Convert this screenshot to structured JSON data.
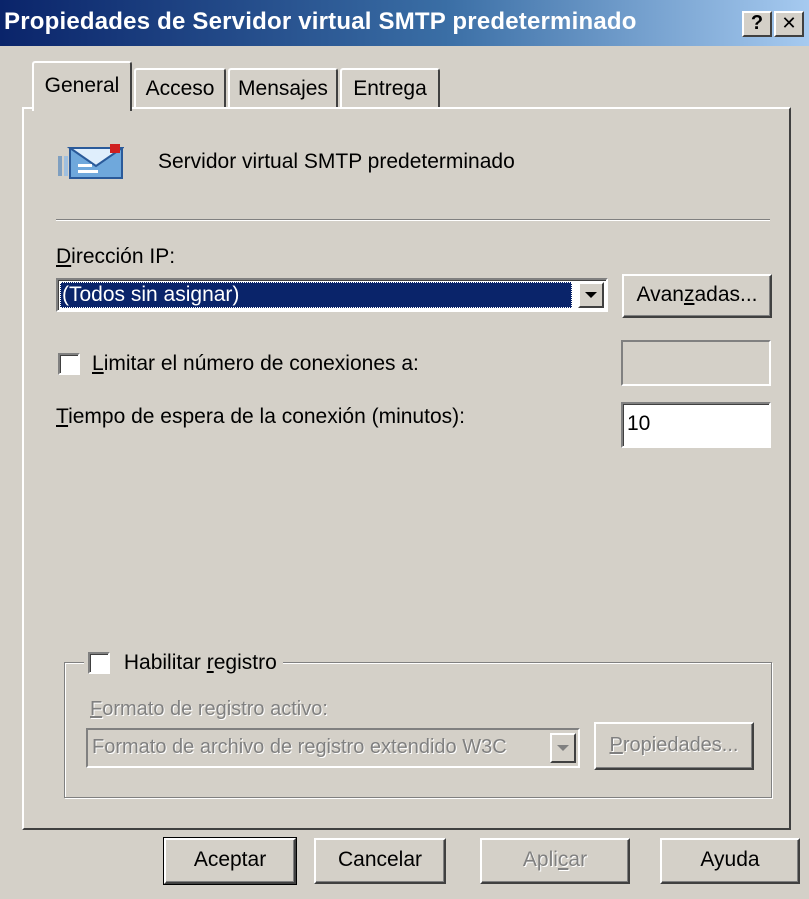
{
  "window": {
    "title": "Propiedades de Servidor virtual SMTP predeterminado",
    "help_button": "?",
    "close_button": "✕",
    "accent": "#0a246a"
  },
  "tabs": [
    {
      "label": "General",
      "active": true
    },
    {
      "label": "Acceso",
      "active": false
    },
    {
      "label": "Mensajes",
      "active": false
    },
    {
      "label": "Entrega",
      "active": false
    }
  ],
  "general": {
    "server_icon": "smtp-mail-server-icon",
    "server_name": "Servidor virtual SMTP predeterminado",
    "ip_label_access": "D",
    "ip_label_rest": "irección IP:",
    "ip_selected": "(Todos sin asignar)",
    "advanced_pre": "Avan",
    "advanced_access": "z",
    "advanced_post": "adas...",
    "limit_checked": false,
    "limit_label_access": "L",
    "limit_label_rest": "imitar el número de conexiones a:",
    "limit_value": "",
    "timeout_label_access": "T",
    "timeout_label_rest": "iempo de espera de la conexión (minutos):",
    "timeout_value": "10"
  },
  "logging": {
    "enabled": false,
    "enable_pre": "Habilitar ",
    "enable_access": "r",
    "enable_post": "egistro",
    "format_label_access": "F",
    "format_label_rest": "ormato de registro activo:",
    "format_selected": "Formato de archivo de registro extendido W3C",
    "properties_access": "P",
    "properties_rest": "ropiedades..."
  },
  "buttons": {
    "ok": "Aceptar",
    "cancel": "Cancelar",
    "apply_pre": "Apli",
    "apply_access": "c",
    "apply_post": "ar",
    "help": "Ayuda"
  }
}
